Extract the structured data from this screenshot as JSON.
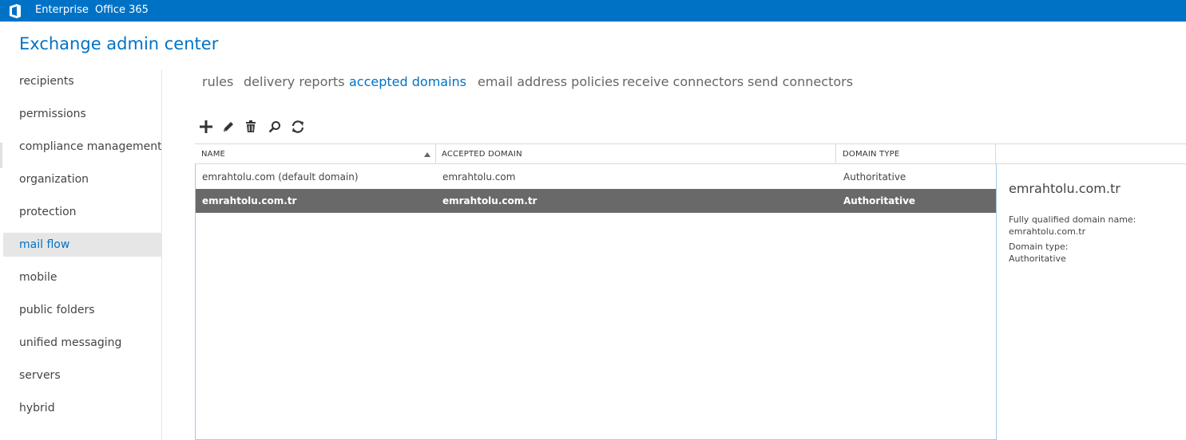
{
  "topbar": {
    "logo_icon": "office-logo-icon",
    "links": [
      "Enterprise",
      "Office 365"
    ],
    "color": "#0072c6"
  },
  "app_title": "Exchange admin center",
  "sidebar": {
    "items": [
      {
        "label": "recipients",
        "active": false
      },
      {
        "label": "permissions",
        "active": false
      },
      {
        "label": "compliance management",
        "active": false
      },
      {
        "label": "organization",
        "active": false
      },
      {
        "label": "protection",
        "active": false
      },
      {
        "label": "mail flow",
        "active": true
      },
      {
        "label": "mobile",
        "active": false
      },
      {
        "label": "public folders",
        "active": false
      },
      {
        "label": "unified messaging",
        "active": false
      },
      {
        "label": "servers",
        "active": false
      },
      {
        "label": "hybrid",
        "active": false
      }
    ]
  },
  "tabs": [
    {
      "label": "rules",
      "active": false
    },
    {
      "label": "delivery reports",
      "active": false
    },
    {
      "label": "accepted domains",
      "active": true
    },
    {
      "label": "email address policies",
      "active": false
    },
    {
      "label": "receive connectors",
      "active": false
    },
    {
      "label": "send connectors",
      "active": false
    }
  ],
  "toolbar": {
    "icons": [
      "add-icon",
      "edit-icon",
      "delete-icon",
      "search-icon",
      "refresh-icon"
    ]
  },
  "grid": {
    "columns": [
      "NAME",
      "ACCEPTED DOMAIN",
      "DOMAIN TYPE"
    ],
    "sort_column": "NAME",
    "sort_direction": "ascending",
    "rows": [
      {
        "name": "emrahtolu.com (default domain)",
        "domain": "emrahtolu.com",
        "type": "Authoritative",
        "selected": false
      },
      {
        "name": "emrahtolu.com.tr",
        "domain": "emrahtolu.com.tr",
        "type": "Authoritative",
        "selected": true
      }
    ]
  },
  "details": {
    "title": "emrahtolu.com.tr",
    "fqdn_label": "Fully qualified domain name:",
    "fqdn_value": "emrahtolu.com.tr",
    "type_label": "Domain type:",
    "type_value": "Authoritative"
  }
}
